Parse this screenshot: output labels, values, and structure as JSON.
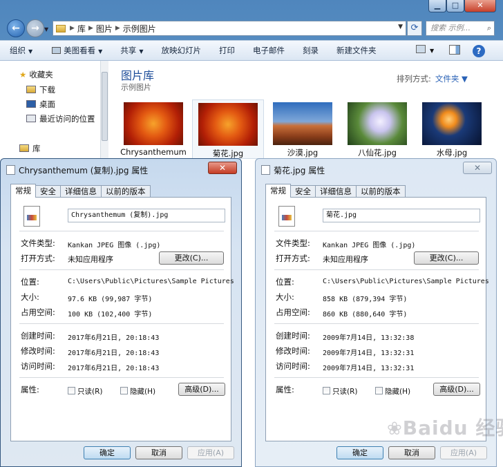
{
  "explorer": {
    "caption": {
      "minimize": "▁",
      "maximize": "□",
      "close": "✕"
    },
    "address": {
      "crumbs": [
        "库",
        "图片",
        "示例图片"
      ]
    },
    "search": {
      "placeholder": "搜索 示例..."
    },
    "toolbar": {
      "organize": "组织",
      "preview": "美图看看",
      "share": "共享",
      "slideshow": "放映幻灯片",
      "print": "打印",
      "email": "电子邮件",
      "burn": "刻录",
      "new_folder": "新建文件夹"
    },
    "nav": {
      "favorites": "收藏夹",
      "downloads": "下载",
      "desktop": "桌面",
      "recent": "最近访问的位置",
      "libraries": "库"
    },
    "library": {
      "title": "图片库",
      "subtitle": "示例图片",
      "arrange_label": "排列方式:",
      "arrange_value": "文件夹"
    },
    "thumbnails": [
      "Chrysanthemum",
      "菊花.jpg",
      "沙漠.jpg",
      "八仙花.jpg",
      "水母.jpg"
    ]
  },
  "tabs": [
    "常规",
    "安全",
    "详细信息",
    "以前的版本"
  ],
  "labels": {
    "type": "文件类型:",
    "opens_with": "打开方式:",
    "location": "位置:",
    "size": "大小:",
    "size_on_disk": "占用空间:",
    "created": "创建时间:",
    "modified": "修改时间:",
    "accessed": "访问时间:",
    "attributes": "属性:"
  },
  "buttons": {
    "change": "更改(C)...",
    "advanced": "高级(D)...",
    "ok": "确定",
    "cancel": "取消",
    "apply": "应用(A)",
    "readonly": "只读(R)",
    "hidden": "隐藏(H)"
  },
  "dialog_left": {
    "title": "Chrysanthemum (复制).jpg 属性",
    "filename": "Chrysanthemum (复制).jpg",
    "type": "Kankan JPEG 图像 (.jpg)",
    "opens_with": "未知应用程序",
    "location": "C:\\Users\\Public\\Pictures\\Sample Pictures",
    "size": "97.6 KB (99,987 字节)",
    "size_on_disk": "100 KB (102,400 字节)",
    "created": "2017年6月21日, 20:18:43",
    "modified": "2017年6月21日, 20:18:43",
    "accessed": "2017年6月21日, 20:18:43"
  },
  "dialog_right": {
    "title": "菊花.jpg 属性",
    "filename": "菊花.jpg",
    "type": "Kankan JPEG 图像 (.jpg)",
    "opens_with": "未知应用程序",
    "location": "C:\\Users\\Public\\Pictures\\Sample Pictures",
    "size": "858 KB (879,394 字节)",
    "size_on_disk": "860 KB (880,640 字节)",
    "created": "2009年7月14日, 13:32:38",
    "modified": "2009年7月14日, 13:32:31",
    "accessed": "2009年7月14日, 13:32:31"
  },
  "watermark": "Baidu 经验"
}
